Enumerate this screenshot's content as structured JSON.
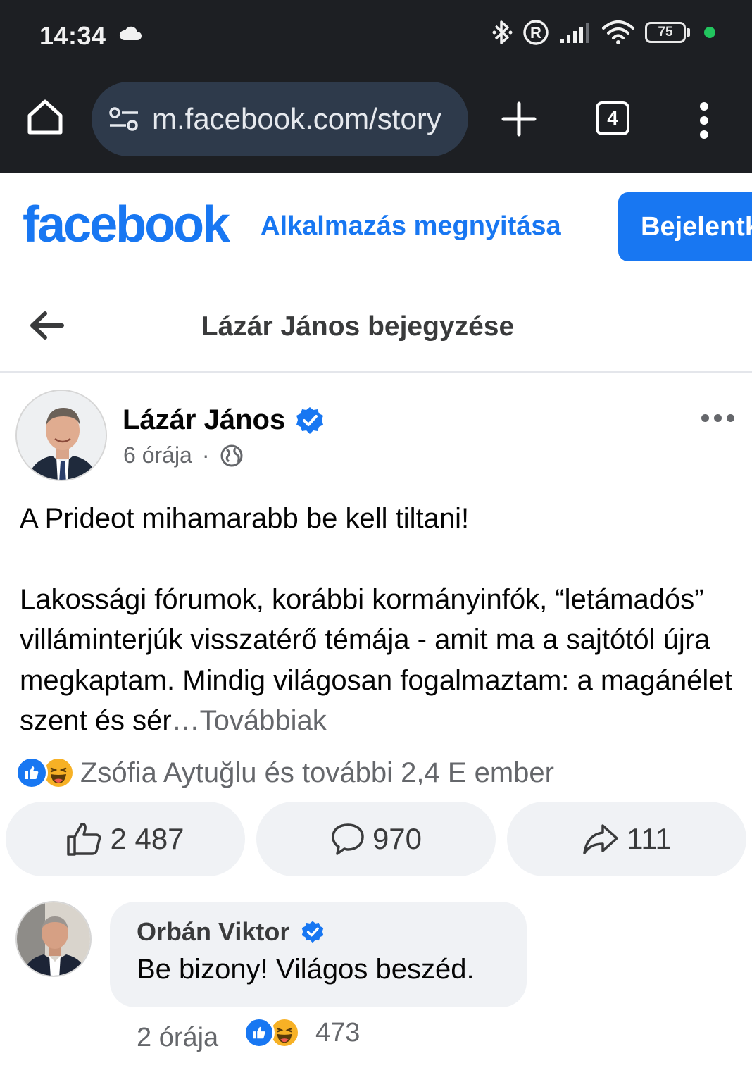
{
  "status_bar": {
    "time": "14:34",
    "battery": "75",
    "icons": [
      "cloud-icon",
      "bluetooth-icon",
      "registered-icon",
      "signal-icon",
      "wifi-icon",
      "battery-icon"
    ]
  },
  "browser": {
    "url": "m.facebook.com/story",
    "tab_count": "4"
  },
  "fb_header": {
    "logo": "facebook",
    "open_app": "Alkalmazás megnyitása",
    "login": "Bejelentkezés"
  },
  "page": {
    "title": "Lázár János bejegyzése"
  },
  "post": {
    "author": "Lázár János",
    "time": "6 órája",
    "separator": "·",
    "headline": "A Prideot mihamarabb be kell tiltani!",
    "body": "Lakossági fórumok, korábbi kormányinfók, “letámadós” villáminterjúk visszatérő témája - amit ma a sajtótól újra megkaptam. Mindig világosan fogalmaztam: a magánélet szent és sér",
    "see_more": "…Továbbiak",
    "reactions_text": "Zsófia Aytuğlu és további 2,4 E ember",
    "likes": "2 487",
    "comments": "970",
    "shares": "111"
  },
  "comment": {
    "author": "Orbán Viktor",
    "text": "Be bizony! Világos beszéd.",
    "time": "2 órája",
    "reaction_count": "473"
  },
  "colors": {
    "fb_blue": "#1877f2",
    "chrome_bg": "#1d1f23",
    "url_bg": "#2e3a4b",
    "muted": "#65676b",
    "pill_bg": "#f0f2f5",
    "haha": "#f7b125"
  }
}
